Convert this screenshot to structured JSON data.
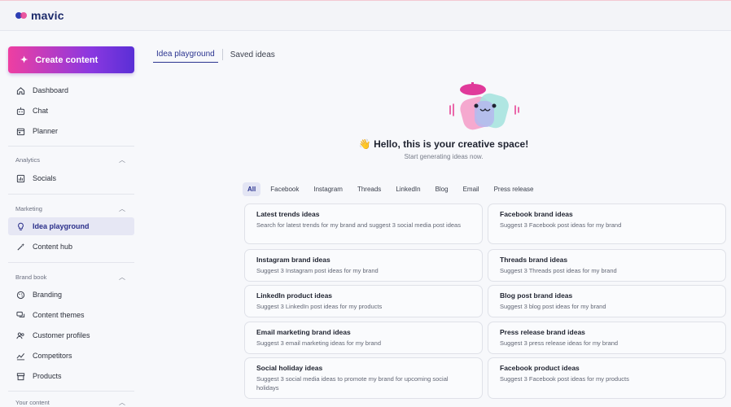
{
  "app": {
    "name": "mavic"
  },
  "sidebar": {
    "create_label": "Create content",
    "main_items": [
      {
        "label": "Dashboard",
        "icon": "home-icon"
      },
      {
        "label": "Chat",
        "icon": "robot-icon"
      },
      {
        "label": "Planner",
        "icon": "calendar-icon"
      }
    ],
    "analytics": {
      "title": "Analytics",
      "items": [
        {
          "label": "Socials",
          "icon": "chart-icon"
        }
      ]
    },
    "marketing": {
      "title": "Marketing",
      "items": [
        {
          "label": "Idea playground",
          "icon": "lightbulb-icon",
          "active": true
        },
        {
          "label": "Content hub",
          "icon": "magic-wand-icon"
        }
      ]
    },
    "brand_book": {
      "title": "Brand book",
      "items": [
        {
          "label": "Branding",
          "icon": "palette-icon"
        },
        {
          "label": "Content themes",
          "icon": "chat-bubbles-icon"
        },
        {
          "label": "Customer profiles",
          "icon": "users-icon"
        },
        {
          "label": "Competitors",
          "icon": "trend-chart-icon"
        },
        {
          "label": "Products",
          "icon": "store-icon"
        }
      ]
    },
    "your_content": {
      "title": "Your content"
    }
  },
  "tabs": [
    {
      "label": "Idea playground",
      "active": true
    },
    {
      "label": "Saved ideas",
      "active": false
    }
  ],
  "hero": {
    "greeting_emoji": "👋",
    "title": "Hello, this is your creative space!",
    "subtitle": "Start generating ideas now."
  },
  "filters": [
    "All",
    "Facebook",
    "Instagram",
    "Threads",
    "LinkedIn",
    "Blog",
    "Email",
    "Press release"
  ],
  "cards": [
    {
      "title": "Latest trends ideas",
      "desc": "Search for latest trends for my brand and suggest 3 social media post ideas"
    },
    {
      "title": "Facebook brand ideas",
      "desc": "Suggest 3 Facebook post ideas for my brand"
    },
    {
      "title": "Instagram brand ideas",
      "desc": "Suggest 3 Instagram post ideas for my brand"
    },
    {
      "title": "Threads brand ideas",
      "desc": "Suggest 3 Threads post ideas for my brand"
    },
    {
      "title": "LinkedIn product ideas",
      "desc": "Suggest 3 LinkedIn post ideas for my products"
    },
    {
      "title": "Blog post brand ideas",
      "desc": "Suggest 3 blog post ideas for my brand"
    },
    {
      "title": "Email marketing brand ideas",
      "desc": "Suggest 3 email marketing ideas for my brand"
    },
    {
      "title": "Press release brand ideas",
      "desc": "Suggest 3 press release ideas for my brand"
    },
    {
      "title": "Social holiday ideas",
      "desc": "Suggest 3 social media ideas to promote my brand for upcoming social holidays"
    },
    {
      "title": "Facebook product ideas",
      "desc": "Suggest 3 Facebook post ideas for my products"
    }
  ],
  "colors": {
    "accent": "#2b3490",
    "brand_gradient_start": "#ee3fa1",
    "brand_gradient_end": "#5a2fd6"
  }
}
